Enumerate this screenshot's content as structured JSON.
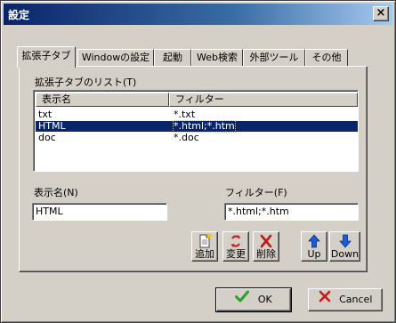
{
  "window": {
    "title": "設定",
    "close_label": "×"
  },
  "tabs": [
    {
      "label": "拡張子タブ",
      "active": true
    },
    {
      "label": "Windowの設定",
      "active": false
    },
    {
      "label": "起動",
      "active": false
    },
    {
      "label": "Web検索",
      "active": false
    },
    {
      "label": "外部ツール",
      "active": false
    },
    {
      "label": "その他",
      "active": false
    }
  ],
  "list": {
    "label": "拡張子タブのリスト(T)",
    "columns": [
      "表示名",
      "フィルター"
    ],
    "rows": [
      {
        "name": "txt",
        "filter": "*.txt",
        "selected": false
      },
      {
        "name": "HTML",
        "filter": "*.html;*.htm",
        "selected": true
      },
      {
        "name": "doc",
        "filter": "*.doc",
        "selected": false
      }
    ]
  },
  "fields": {
    "name_label": "表示名(N)",
    "name_value": "HTML",
    "filter_label": "フィルター(F)",
    "filter_value": "*.html;*.htm"
  },
  "toolbar": {
    "add_label": "追加",
    "change_label": "変更",
    "delete_label": "削除",
    "up_label": "Up",
    "down_label": "Down"
  },
  "footer": {
    "ok_label": "OK",
    "cancel_label": "Cancel"
  },
  "colors": {
    "title_bar": "#0a246a",
    "face": "#d4d0c8",
    "selection": "#0a246a",
    "ok_check": "#2e9e2e",
    "cancel_x": "#cc1a1a",
    "arrow_blue": "#1c5ad6"
  },
  "icons": {
    "add": "new-document-icon",
    "change": "refresh-icon",
    "delete": "delete-x-icon",
    "up": "arrow-up-icon",
    "down": "arrow-down-icon",
    "ok": "checkmark-icon",
    "cancel": "cancel-x-icon"
  }
}
